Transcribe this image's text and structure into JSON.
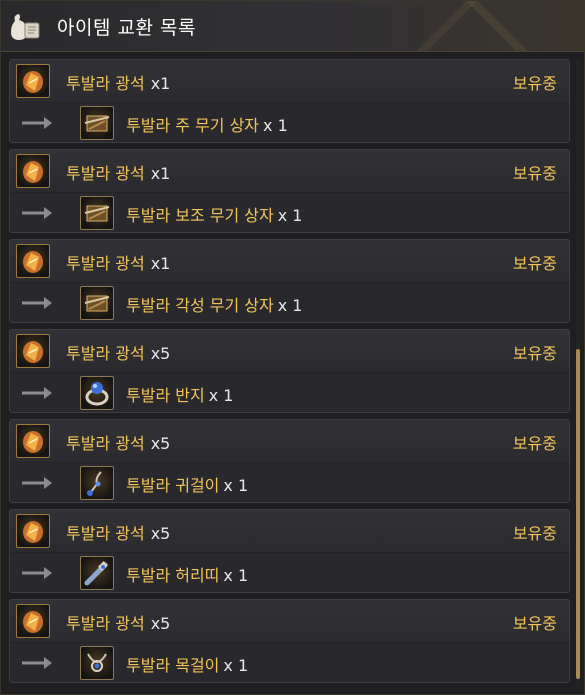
{
  "header": {
    "title": "아이템 교환 목록",
    "icon": "pouch-scroll-icon"
  },
  "colors": {
    "gold": "#f3c45a",
    "white": "#e8e8e8",
    "panel": "#2c2c30",
    "accent": "#a88a4e"
  },
  "entries": [
    {
      "material": "투발라 광석",
      "material_qty": "x1",
      "status": "보유중",
      "reward": "투발라 주 무기 상자",
      "reward_qty": "x 1",
      "reward_icon": "weapon-box-icon"
    },
    {
      "material": "투발라 광석",
      "material_qty": "x1",
      "status": "보유중",
      "reward": "투발라 보조 무기 상자",
      "reward_qty": "x 1",
      "reward_icon": "weapon-box-icon"
    },
    {
      "material": "투발라 광석",
      "material_qty": "x1",
      "status": "보유중",
      "reward": "투발라 각성 무기 상자",
      "reward_qty": "x 1",
      "reward_icon": "weapon-box-icon"
    },
    {
      "material": "투발라 광석",
      "material_qty": "x5",
      "status": "보유중",
      "reward": "투발라 반지",
      "reward_qty": "x 1",
      "reward_icon": "ring-icon"
    },
    {
      "material": "투발라 광석",
      "material_qty": "x5",
      "status": "보유중",
      "reward": "투발라 귀걸이",
      "reward_qty": "x 1",
      "reward_icon": "earring-icon"
    },
    {
      "material": "투발라 광석",
      "material_qty": "x5",
      "status": "보유중",
      "reward": "투발라 허리띠",
      "reward_qty": "x 1",
      "reward_icon": "belt-icon"
    },
    {
      "material": "투발라 광석",
      "material_qty": "x5",
      "status": "보유중",
      "reward": "투발라 목걸이",
      "reward_qty": "x 1",
      "reward_icon": "necklace-icon"
    }
  ]
}
